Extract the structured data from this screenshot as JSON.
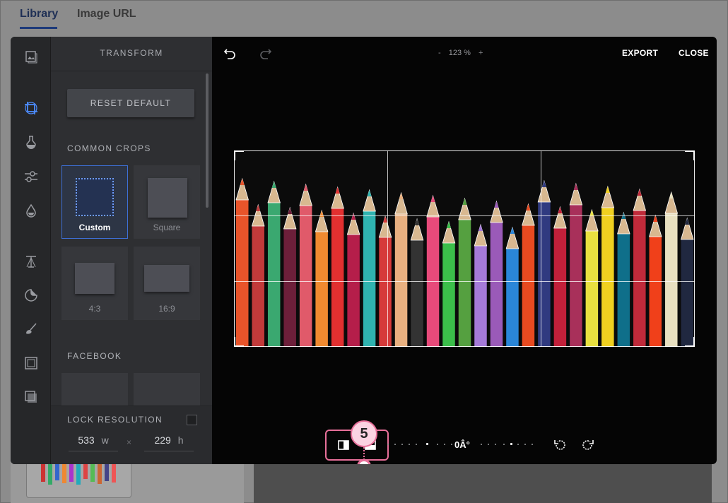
{
  "background": {
    "tabs": [
      {
        "label": "Library",
        "active": true
      },
      {
        "label": "Image URL",
        "active": false
      }
    ]
  },
  "editor": {
    "panel": {
      "title": "TRANSFORM",
      "reset_label": "RESET DEFAULT",
      "common_crops_label": "COMMON CROPS",
      "crops": [
        {
          "label": "Custom",
          "selected": true
        },
        {
          "label": "Square",
          "selected": false
        },
        {
          "label": "4:3",
          "selected": false
        },
        {
          "label": "16:9",
          "selected": false
        }
      ],
      "facebook_label": "FACEBOOK",
      "lock_resolution_label": "LOCK RESOLUTION",
      "lock_resolution_checked": false,
      "width_value": "533",
      "width_unit": "w",
      "times": "×",
      "height_value": "229",
      "height_unit": "h"
    },
    "rail_icons": [
      "gallery-icon",
      "crop-icon",
      "filter-icon",
      "adjust-sliders-icon",
      "drop-icon",
      "text-icon",
      "sticker-icon",
      "brush-icon",
      "frame-icon",
      "overlay-icon"
    ],
    "topbar": {
      "zoom_minus": "-",
      "zoom_value": "123 %",
      "zoom_plus": "+",
      "export_label": "EXPORT",
      "close_label": "CLOSE"
    },
    "bottom": {
      "angle_label": "0Â°",
      "callout_number": "5"
    },
    "colors": {
      "accent": "#3d6fd6",
      "callout": "#e8709a",
      "panel": "#2e2f32",
      "rail": "#262729"
    }
  }
}
